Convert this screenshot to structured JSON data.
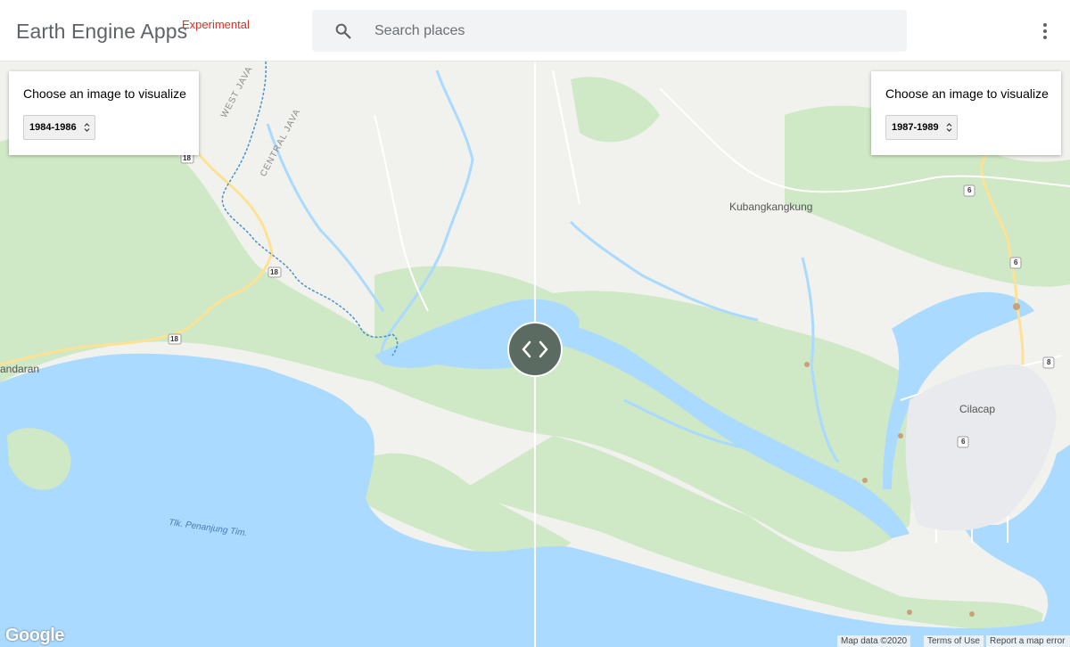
{
  "header": {
    "title": "Earth Engine Apps",
    "badge": "Experimental",
    "badge_color": "#d93025",
    "search_icon": "search-icon",
    "menu_icon": "more-vert-icon"
  },
  "search": {
    "placeholder": "Search places",
    "value": ""
  },
  "left_panel": {
    "heading": "Choose an image to visualize",
    "selected": "1984-1986"
  },
  "right_panel": {
    "heading": "Choose an image to visualize",
    "selected": "1987-1989"
  },
  "slider": {
    "icon": "code-arrows-icon"
  },
  "map": {
    "labels": {
      "west_java": "WEST JAVA",
      "central_java": "CENTRAL JAVA",
      "kubangkangkung": "Kubangkangkung",
      "cilacap": "Cilacap",
      "pangandaran_fragment": "andaran",
      "bay": "Tlk. Penanjung Tim."
    },
    "road_shields": [
      "18",
      "18",
      "18",
      "6",
      "6",
      "6",
      "8"
    ],
    "colors": {
      "water": "#aadaff",
      "land": "#f1f2ee",
      "vegetation": "#cfe8c6",
      "road": "#fde293",
      "border": "#4a90c8"
    }
  },
  "footer": {
    "logo": "Google",
    "map_data": "Map data ©2020",
    "terms": "Terms of Use",
    "report": "Report a map error"
  }
}
